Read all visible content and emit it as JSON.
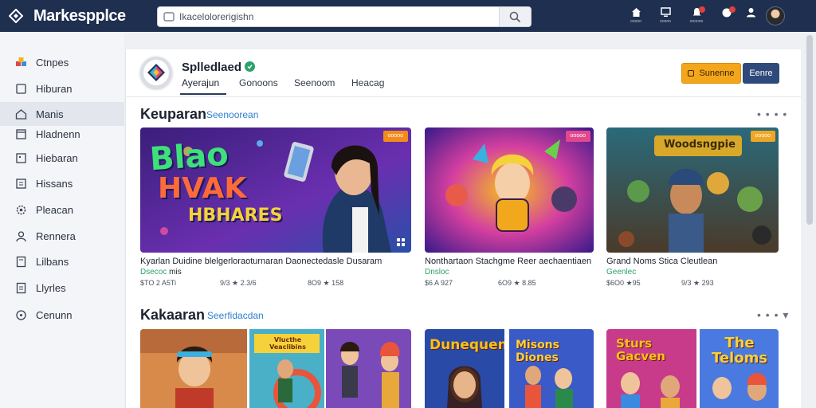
{
  "app": {
    "name": "Markespplce"
  },
  "search": {
    "value": "Ikacelolorerigishn"
  },
  "topbar": {
    "icons": [
      {
        "icon": "home-icon",
        "label": "ooooo"
      },
      {
        "icon": "monitor-icon",
        "label": "ooooo"
      },
      {
        "icon": "bell-icon",
        "label": "oooooo"
      },
      {
        "icon": "chat-icon",
        "label": ""
      },
      {
        "icon": "user-icon",
        "label": ""
      }
    ]
  },
  "sidebar": {
    "items": [
      {
        "label": "Ctnpes",
        "icon": "cubes-icon",
        "active": false
      },
      {
        "label": "Hiburan",
        "icon": "square-icon",
        "active": false
      },
      {
        "label": "Manis",
        "icon": "home-icon",
        "active": true
      },
      {
        "label": "Hladnenn",
        "icon": "window-icon",
        "active": false
      },
      {
        "label": "Hiebaran",
        "icon": "grid-icon",
        "active": false
      },
      {
        "label": "Hissans",
        "icon": "list-icon",
        "active": false
      },
      {
        "label": "Pleacan",
        "icon": "gear-icon",
        "active": false
      },
      {
        "label": "Rennera",
        "icon": "person-icon",
        "active": false
      },
      {
        "label": "Lilbans",
        "icon": "book-icon",
        "active": false
      },
      {
        "label": "Llyrles",
        "icon": "doc-icon",
        "active": false
      },
      {
        "label": "Cenunn",
        "icon": "circle-icon",
        "active": false
      }
    ]
  },
  "store": {
    "name": "Splledlaed",
    "tabs": [
      "Ayerajun",
      "Gonoons",
      "Seenoom",
      "Heacag"
    ],
    "primary_button": "Sunenne",
    "secondary_button": "Eenre"
  },
  "sections": [
    {
      "title": "Keuparan",
      "subtitle": "Seenoorean",
      "more": "• • • •"
    },
    {
      "title": "Kakaaran",
      "subtitle": "Seerfidacdan",
      "more": "• • • ▾"
    }
  ],
  "cards": [
    {
      "title": "Kyarlan Duidine blelgerloraoturnaran Daonectedasle Dusaram",
      "status": "Dsecoc",
      "status_extra": "mis",
      "meta_left": "$TO 2 A5Ti",
      "meta_right": "9/3 ★ 2.3/6",
      "meta_far": "8O9 ★ 158",
      "badge": "ooooo",
      "img_text": [
        "Blao",
        "HVAK",
        "HBHARES"
      ]
    },
    {
      "title": "Nonthartaon Stachgme Reer aechaentiaen",
      "status": "Dnsloc",
      "meta_left": "$6 A 927",
      "meta_right": "6O9 ★ 8.85",
      "badge": "ooooo"
    },
    {
      "title": "Grand Noms Stica Cleutlean",
      "status": "Geenlec",
      "meta_left": "$6O0 ★95",
      "meta_right": "9/3 ★ 293",
      "badge": "ooooo",
      "img_text": [
        "Woodsngpie"
      ]
    }
  ],
  "row2_img_text": [
    "Vlucthe Veaclibins",
    "Dunequen",
    "Misons Diones",
    "Sturs Gacven",
    "The Teloms"
  ],
  "colors": {
    "topbar": "#1e2f4f",
    "accent": "#f4a61b",
    "link": "#2f7fd0",
    "verified": "#2aa36a"
  }
}
